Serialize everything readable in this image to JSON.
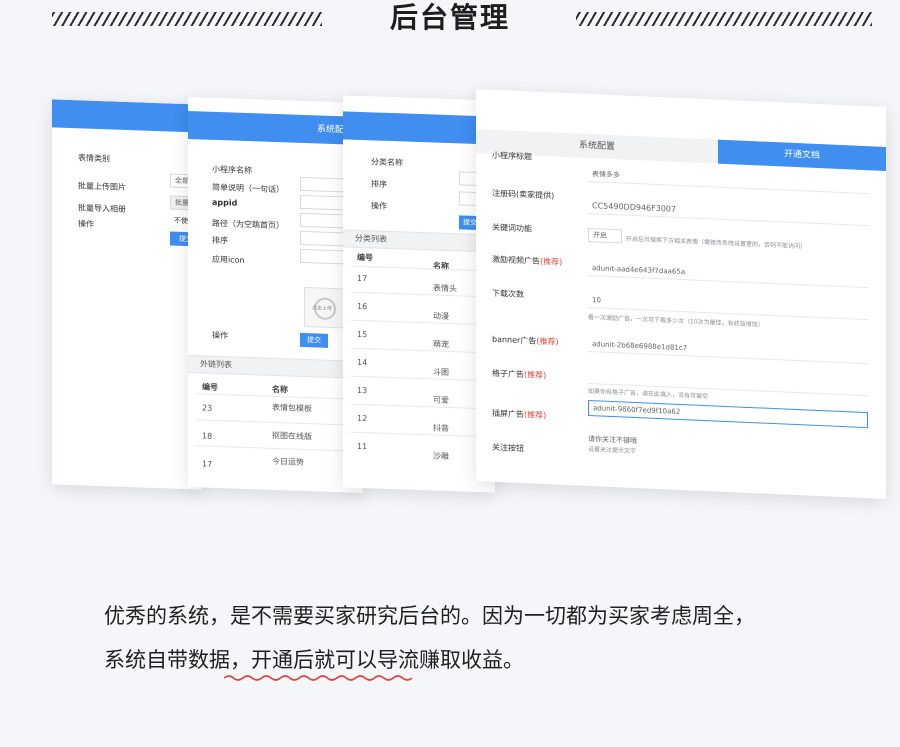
{
  "header": {
    "title": "后台管理"
  },
  "panel1": {
    "rows": [
      "表情类别",
      "批量上传图片",
      "批量导入相册",
      "操作"
    ],
    "inputs": [
      "全部",
      "批量",
      "不使",
      "提交"
    ]
  },
  "panel2": {
    "bar_title": "系统配置",
    "fields": [
      "小程序名称",
      "简单说明（一句话）",
      "appid",
      "路径（为空跳首页）",
      "排序",
      "应用icon"
    ],
    "upload_text": "点击上传",
    "op_label": "操作",
    "submit": "提交",
    "section": "外链列表",
    "table_headers": [
      "编号",
      "名称"
    ],
    "rows": [
      {
        "id": "23",
        "name": "表情包模板"
      },
      {
        "id": "18",
        "name": "抠图在线版"
      },
      {
        "id": "17",
        "name": "今日运势"
      }
    ]
  },
  "panel3": {
    "fields": [
      "分类名称",
      "排序",
      "操作"
    ],
    "submit": "提交",
    "section": "分类列表",
    "table_headers": [
      "编号",
      "名称"
    ],
    "rows": [
      {
        "id": "17",
        "name": "表情头"
      },
      {
        "id": "16",
        "name": "动漫"
      },
      {
        "id": "15",
        "name": "萌宠"
      },
      {
        "id": "14",
        "name": "斗图"
      },
      {
        "id": "13",
        "name": "可爱"
      },
      {
        "id": "12",
        "name": "抖音"
      },
      {
        "id": "11",
        "name": "沙雕"
      }
    ]
  },
  "panel4": {
    "tab_active": "系统配置",
    "tab_other": "开通文档",
    "fields": [
      {
        "label": "小程序标题",
        "value": "表情多多"
      },
      {
        "label": "注册码(卖家提供)",
        "value": "CC5490DD946F3007"
      },
      {
        "label": "关键词功能",
        "value": "开启",
        "note": "开启后可搜索下方相关表情（需修改系统设置里的，否则不能访问）"
      },
      {
        "label": "激励视频广告",
        "tag": "(推荐)",
        "value": "adunit-aad4e643f7daa65a"
      },
      {
        "label": "下载次数",
        "value": "10",
        "note": "看一次激励广告，一次可下载多少次（10次为最佳，有收益增加）"
      },
      {
        "label": "banner广告",
        "tag": "(推荐)",
        "value": "adunit-2b68e6988e1d81c7"
      },
      {
        "label": "格子广告",
        "tag": "(推荐)",
        "value": "",
        "note": "如果你有格子广告，请在此填入，没有可留空"
      },
      {
        "label": "插屏广告",
        "tag": "(推荐)",
        "value": "adunit-9860f7ed9f10a62"
      },
      {
        "label": "关注按钮",
        "value": "请你关注不错哦",
        "note": "设置关注提示文字"
      }
    ]
  },
  "caption": {
    "line1": "优秀的系统，是不需要买家研究后台的。因为一切都为买家考虑周全，",
    "line2": "系统自带数据，开通后就可以导流赚取收益。"
  },
  "colors": {
    "accent": "#3f8ef0",
    "recommend": "#e0443a",
    "wavy": "#e5433c"
  },
  "icons": {
    "upload": "image-placeholder-icon"
  }
}
